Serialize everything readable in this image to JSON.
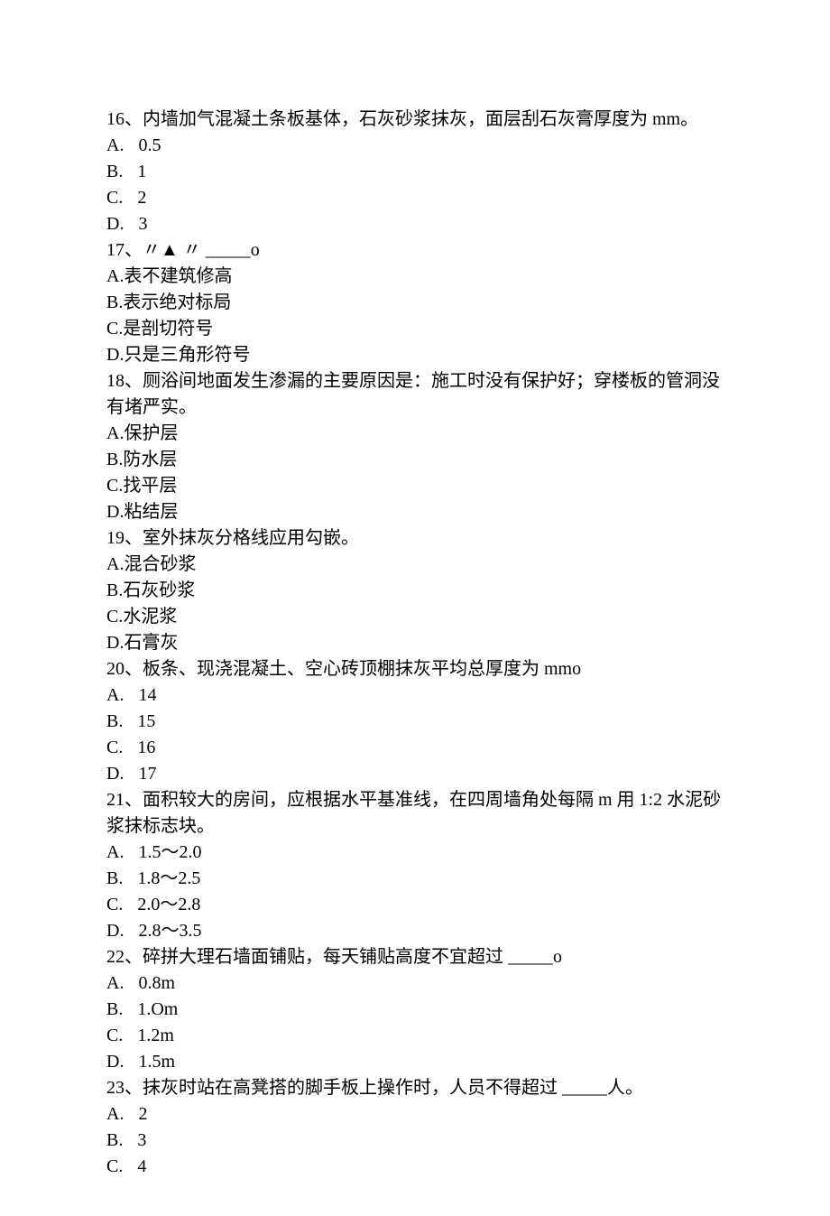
{
  "questions": [
    {
      "num": "16、",
      "text": "内墙加气混凝土条板基体，石灰砂浆抹灰，面层刮石灰膏厚度为 mm。",
      "options": [
        {
          "letter": "A.",
          "label": "0.5",
          "spaced": true
        },
        {
          "letter": "B.",
          "label": "1",
          "spaced": true
        },
        {
          "letter": "C.",
          "label": "2",
          "spaced": true
        },
        {
          "letter": "D.",
          "label": "3",
          "spaced": true
        }
      ]
    },
    {
      "num": "17、",
      "text": "〃▲ 〃 _____o",
      "options": [
        {
          "letter": "A.",
          "label": "表不建筑修高",
          "spaced": false
        },
        {
          "letter": "B.",
          "label": "表示绝对标局",
          "spaced": false
        },
        {
          "letter": "C.",
          "label": "是剖切符号",
          "spaced": false
        },
        {
          "letter": "D.",
          "label": "只是三角形符号",
          "spaced": false
        }
      ]
    },
    {
      "num": "18、",
      "text": "厕浴间地面发生渗漏的主要原因是：施工时没有保护好；穿楼板的管洞没有堵严实。",
      "options": [
        {
          "letter": "A.",
          "label": "保护层",
          "spaced": false
        },
        {
          "letter": "B.",
          "label": "防水层",
          "spaced": false
        },
        {
          "letter": "C.",
          "label": "找平层",
          "spaced": false
        },
        {
          "letter": "D.",
          "label": "粘结层",
          "spaced": false
        }
      ]
    },
    {
      "num": "19、",
      "text": "室外抹灰分格线应用勾嵌。",
      "options": [
        {
          "letter": "A.",
          "label": "混合砂浆",
          "spaced": false
        },
        {
          "letter": "B.",
          "label": "石灰砂浆",
          "spaced": false
        },
        {
          "letter": "C.",
          "label": "水泥浆",
          "spaced": false
        },
        {
          "letter": "D.",
          "label": "石膏灰",
          "spaced": false
        }
      ]
    },
    {
      "num": "20、",
      "text": "板条、现浇混凝土、空心砖顶棚抹灰平均总厚度为 mmo",
      "options": [
        {
          "letter": "A.",
          "label": "14",
          "spaced": true
        },
        {
          "letter": "B.",
          "label": "15",
          "spaced": true
        },
        {
          "letter": "C.",
          "label": "16",
          "spaced": true
        },
        {
          "letter": "D.",
          "label": "17",
          "spaced": true
        }
      ]
    },
    {
      "num": "21、",
      "text": "面积较大的房间，应根据水平基准线，在四周墙角处每隔 m 用 1:2 水泥砂浆抹标志块。",
      "options": [
        {
          "letter": "A.",
          "label": "1.5～2.0",
          "spaced": true
        },
        {
          "letter": "B.",
          "label": "1.8～2.5",
          "spaced": true
        },
        {
          "letter": "C.",
          "label": "2.0～2.8",
          "spaced": true
        },
        {
          "letter": "D.",
          "label": "2.8～3.5",
          "spaced": true
        }
      ]
    },
    {
      "num": "22、",
      "text": "碎拼大理石墙面铺贴，每天铺贴高度不宜超过 _____o",
      "options": [
        {
          "letter": "A.",
          "label": "0.8m",
          "spaced": true
        },
        {
          "letter": "B.",
          "label": "1.Om",
          "spaced": true
        },
        {
          "letter": "C.",
          "label": "1.2m",
          "spaced": true
        },
        {
          "letter": "D.",
          "label": "1.5m",
          "spaced": true
        }
      ]
    },
    {
      "num": "23、",
      "text": "抹灰时站在高凳搭的脚手板上操作时，人员不得超过 _____人。",
      "options": [
        {
          "letter": "A.",
          "label": "2",
          "spaced": true
        },
        {
          "letter": "B.",
          "label": "3",
          "spaced": true
        },
        {
          "letter": "C.",
          "label": "4",
          "spaced": true
        }
      ]
    }
  ]
}
